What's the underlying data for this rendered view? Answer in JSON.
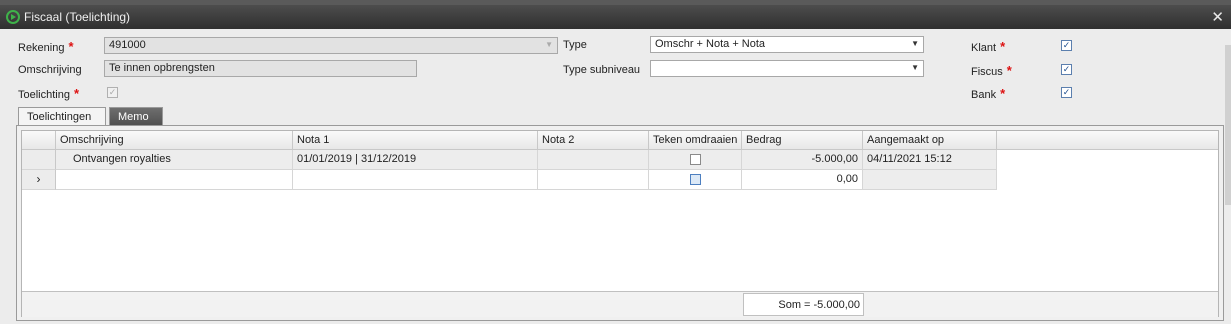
{
  "window": {
    "title": "Fiscaal (Toelichting)",
    "close_label": "✕"
  },
  "form": {
    "rekening_label": "Rekening",
    "rekening_value": "491000",
    "omschrijving_label": "Omschrijving",
    "omschrijving_value": "Te innen opbrengsten",
    "toelichting_label": "Toelichting",
    "toelichting_checked": true,
    "type_label": "Type",
    "type_value": "Omschr + Nota + Nota",
    "type_subniveau_label": "Type subniveau",
    "type_subniveau_value": "",
    "klant_label": "Klant",
    "fiscus_label": "Fiscus",
    "bank_label": "Bank",
    "required_marker": "*"
  },
  "tabs": [
    {
      "label": "Toelichtingen",
      "active": true
    },
    {
      "label": "Memo",
      "active": false
    }
  ],
  "grid": {
    "columns": [
      "Omschrijving",
      "Nota 1",
      "Nota 2",
      "Teken omdraaien",
      "Bedrag",
      "Aangemaakt op"
    ],
    "rows": [
      {
        "omschrijving": "Ontvangen royalties",
        "nota1": "01/01/2019 | 31/12/2019",
        "nota2": "",
        "teken_omdraaien": false,
        "bedrag": "-5.000,00",
        "aangemaakt_op": "04/11/2021 15:12"
      },
      {
        "omschrijving": "",
        "nota1": "",
        "nota2": "",
        "teken_omdraaien": false,
        "bedrag": "0,00",
        "aangemaakt_op": ""
      }
    ],
    "new_row_indicator": "›",
    "sum_label": "Som = -5.000,00"
  },
  "icons": {
    "app": "app-logo-icon",
    "dropdown": "chevron-down-icon",
    "check": "checkmark-icon",
    "close": "close-icon"
  }
}
